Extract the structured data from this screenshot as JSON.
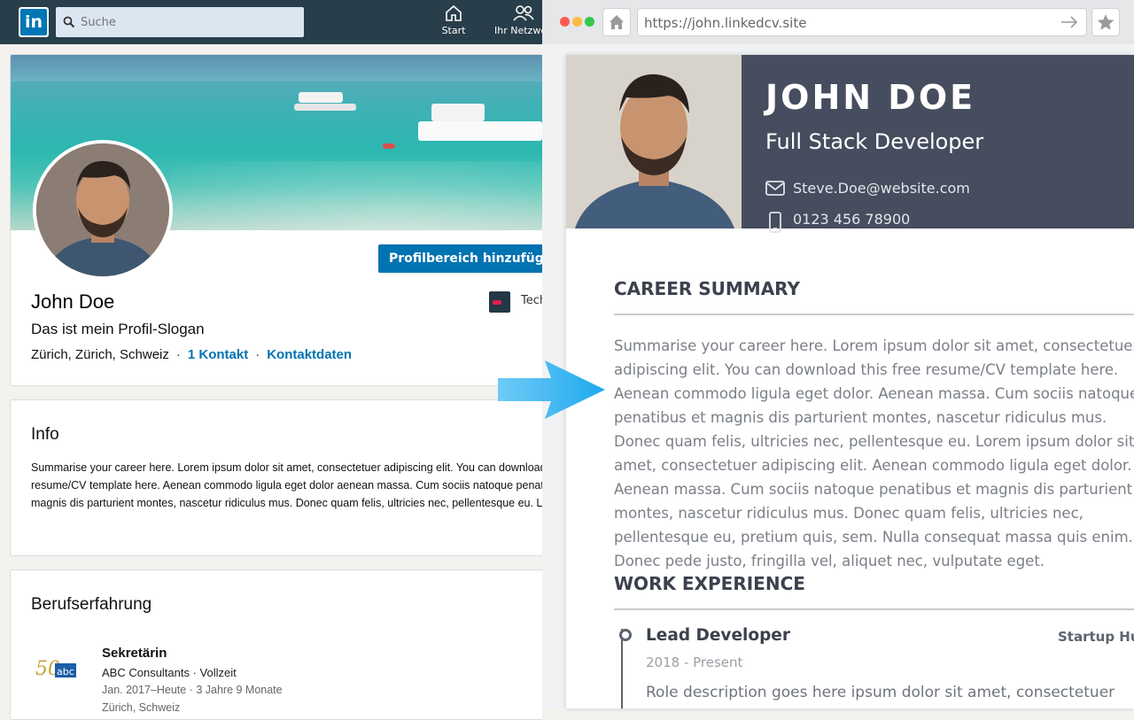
{
  "linkedin": {
    "logo": "in",
    "search_placeholder": "Suche",
    "nav": [
      {
        "label": "Start",
        "icon": "home-icon"
      },
      {
        "label": "Ihr Netzwe",
        "icon": "network-icon"
      }
    ],
    "profile": {
      "button_add_section": "Profilbereich hinzufügen",
      "company_label": "Tech",
      "name": "John Doe",
      "slogan": "Das ist mein Profil-Slogan",
      "location": "Zürich, Zürich, Schweiz",
      "connections": "1 Kontakt",
      "contact_info": "Kontaktdaten"
    },
    "info": {
      "title": "Info",
      "text": "Summarise your career here. Lorem ipsum dolor sit amet, consectetuer adipiscing elit. You can download this free resume/CV template here. Aenean commodo ligula eget dolor aenean massa. Cum sociis natoque penatibus et magnis dis parturient montes, nascetur ridiculus mus. Donec quam felis, ultricies nec, pellentesque eu. Lorem"
    },
    "experience": {
      "title": "Berufserfahrung",
      "logo_text": "50 abc",
      "job_title": "Sekretärin",
      "company": "ABC Consultants · Vollzeit",
      "dates": "Jan. 2017–Heute · 3 Jahre 9 Monate",
      "location": "Zürich, Schweiz"
    }
  },
  "browser": {
    "url": "https://john.linkedcv.site",
    "traffic_light_colors": [
      "#fd5753",
      "#fdbc40",
      "#34c84a"
    ]
  },
  "cv": {
    "name": "JOHN DOE",
    "role": "Full Stack Developer",
    "email": "Steve.Doe@website.com",
    "phone": "0123 456 78900",
    "career_summary_title": "CAREER SUMMARY",
    "career_summary_text": "Summarise your career here. Lorem ipsum dolor sit amet, consectetuer adipiscing elit. You can download this free resume/CV template here. Aenean commodo ligula eget dolor. Aenean massa. Cum sociis natoque penatibus et magnis dis parturient montes, nascetur ridiculus mus. Donec quam felis, ultricies nec, pellentesque eu. Lorem ipsum dolor sit amet, consectetuer adipiscing elit. Aenean commodo ligula eget dolor. Aenean massa. Cum sociis natoque penatibus et magnis dis parturient montes, nascetur ridiculus mus. Donec quam felis, ultricies nec, pellentesque eu, pretium quis, sem. Nulla consequat massa quis enim. Donec pede justo, fringilla vel, aliquet nec, vulputate eget.",
    "work_experience_title": "WORK EXPERIENCE",
    "job": {
      "title": "Lead Developer",
      "company": "Startup Hubs",
      "dates": "2018 - Present",
      "description": "Role description goes here ipsum dolor sit amet, consectetuer"
    }
  },
  "colors": {
    "linkedin_nav": "#283e4a",
    "linkedin_blue": "#0073b1",
    "cv_header": "#454d5e",
    "arrow": "#33b5f5"
  }
}
